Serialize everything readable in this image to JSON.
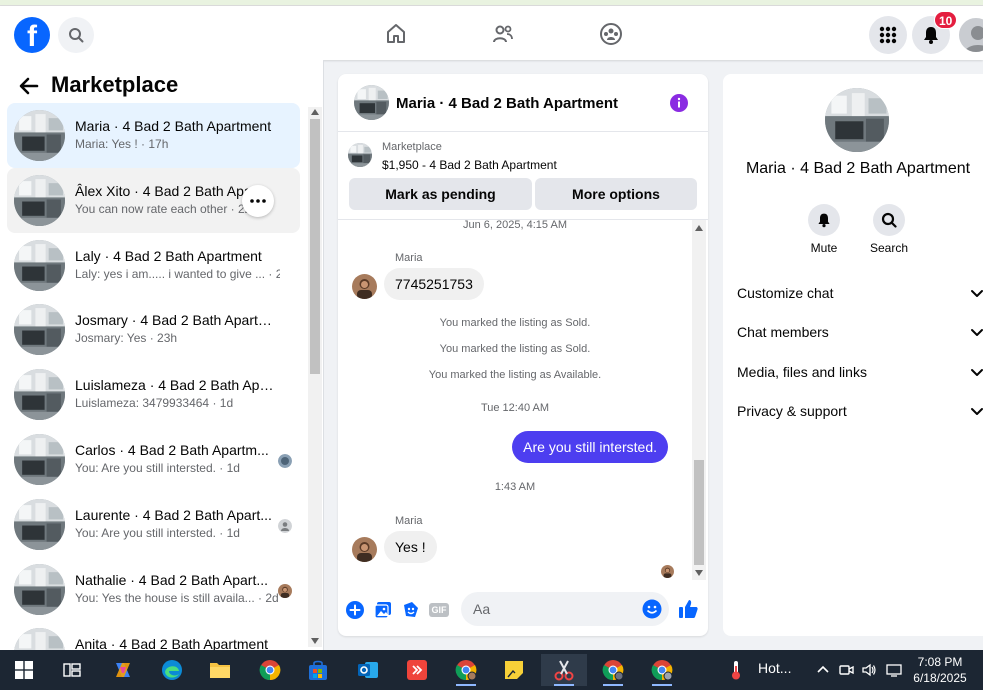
{
  "topbar": {
    "logo_letter": "f",
    "notifications_count": "10"
  },
  "sidebar": {
    "title": "Marketplace",
    "conversations": [
      {
        "title": "Maria · 4 Bad 2 Bath Apartment",
        "subtitle": "Maria: Yes ! · 17h",
        "state": "active"
      },
      {
        "title": "Âlex Xito · 4 Bad 2 Bath Apartment",
        "subtitle": "You can now rate each other · 22h",
        "state": "hover"
      },
      {
        "title": "Laly · 4 Bad 2 Bath Apartment",
        "subtitle": "Laly: yes i am..... i wanted to give ... · 22h",
        "state": ""
      },
      {
        "title": "Josmary · 4 Bad 2 Bath Apartm...",
        "subtitle": "Josmary: Yes · 23h",
        "state": ""
      },
      {
        "title": "Luislameza · 4 Bad 2 Bath Apart...",
        "subtitle": "Luislameza: 3479933464 · 1d",
        "state": ""
      },
      {
        "title": "Carlos · 4 Bad 2 Bath Apartm...",
        "subtitle": "You: Are you still intersted. · 1d",
        "state": ""
      },
      {
        "title": "Laurente · 4 Bad 2 Bath Apart...",
        "subtitle": "You: Are you still intersted. · 1d",
        "state": ""
      },
      {
        "title": "Nathalie · 4 Bad 2 Bath Apart...",
        "subtitle": "You: Yes the house is still availa... · 2d",
        "state": ""
      },
      {
        "title": "Anita · 4 Bad 2 Bath Apartment",
        "subtitle": "",
        "state": ""
      }
    ]
  },
  "chat": {
    "title": "Maria · 4 Bad 2 Bath Apartment",
    "listing_source": "Marketplace",
    "listing_price": "$1,950 - 4 Bad 2 Bath Apartment",
    "mark_pending_label": "Mark as pending",
    "more_options_label": "More options",
    "messages": {
      "date_top": "Jun 6, 2025, 4:15 AM",
      "sender1": "Maria",
      "msg_phone": "7745251753",
      "sys1": "You marked the listing as Sold.",
      "sys2": "You marked the listing as Sold.",
      "sys3": "You marked the listing as Available.",
      "time2": "Tue 12:40 AM",
      "msg_out": "Are you still intersted.",
      "time3": "1:43 AM",
      "sender2": "Maria",
      "msg_yes": "Yes !"
    },
    "composer_placeholder": "Aa",
    "gif_label": "GIF"
  },
  "details": {
    "name": "Maria · 4 Bad 2 Bath Apartment",
    "mute_label": "Mute",
    "search_label": "Search",
    "sections": [
      "Customize chat",
      "Chat members",
      "Media, files and links",
      "Privacy & support"
    ]
  },
  "taskbar": {
    "weather": "Hot...",
    "time": "7:08 PM",
    "date": "6/18/2025"
  },
  "colors": {
    "brand": "#0866ff",
    "outgoing_bubble": "#4d3ef0",
    "info_icon": "#8a2be2",
    "badge": "#e41e3f"
  }
}
